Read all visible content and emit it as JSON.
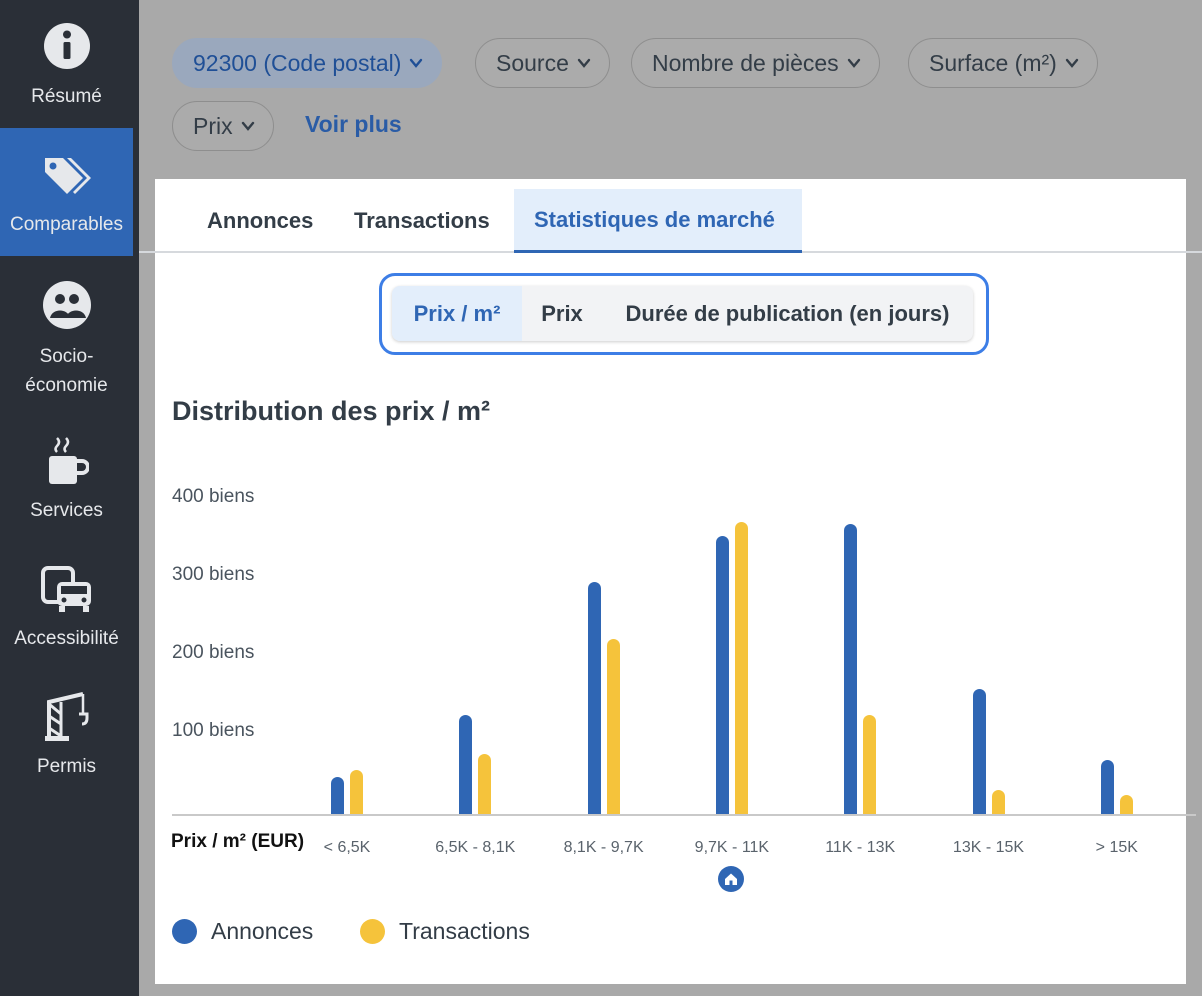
{
  "sidebar": {
    "items": [
      {
        "label": "Résumé",
        "icon": "info-icon"
      },
      {
        "label": "Comparables",
        "icon": "tags-icon"
      },
      {
        "label": "Socio-\néconomie",
        "icon": "people-icon"
      },
      {
        "label": "Services",
        "icon": "coffee-icon"
      },
      {
        "label": "Accessibilité",
        "icon": "transport-icon"
      },
      {
        "label": "Permis",
        "icon": "crane-icon"
      }
    ],
    "active_color": "#2f66b4"
  },
  "filters": {
    "chips": [
      {
        "label": "92300 (Code postal)"
      },
      {
        "label": "Source"
      },
      {
        "label": "Nombre de pièces"
      },
      {
        "label": "Surface (m²)"
      },
      {
        "label": "Prix"
      }
    ],
    "more_label": "Voir plus"
  },
  "tabs": [
    {
      "label": "Annonces"
    },
    {
      "label": "Transactions"
    },
    {
      "label": "Statistiques de marché"
    }
  ],
  "segments": [
    {
      "label": "Prix / m²"
    },
    {
      "label": "Prix"
    },
    {
      "label": "Durée de publication (en jours)"
    }
  ],
  "chart_data": {
    "type": "bar",
    "title": "Distribution des prix / m²",
    "xlabel": "Prix / m² (EUR)",
    "ylabel": "",
    "yticks": [
      "100 biens",
      "200 biens",
      "300 biens",
      "400 biens"
    ],
    "ylim": [
      0,
      400
    ],
    "categories": [
      "< 6,5K",
      "6,5K - 8,1K",
      "8,1K - 9,7K",
      "9,7K - 11K",
      "11K - 13K",
      "13K - 15K",
      "> 15K"
    ],
    "series": [
      {
        "name": "Annonces",
        "color": "#2f66b4",
        "values": [
          47,
          127,
          297,
          357,
          372,
          160,
          69
        ]
      },
      {
        "name": "Transactions",
        "color": "#f5c33b",
        "values": [
          56,
          77,
          225,
          374,
          127,
          31,
          25
        ]
      }
    ],
    "marker_category": "9,7K - 11K",
    "marker_icon": "home-icon",
    "legend_position": "bottom-left",
    "grid": false
  }
}
